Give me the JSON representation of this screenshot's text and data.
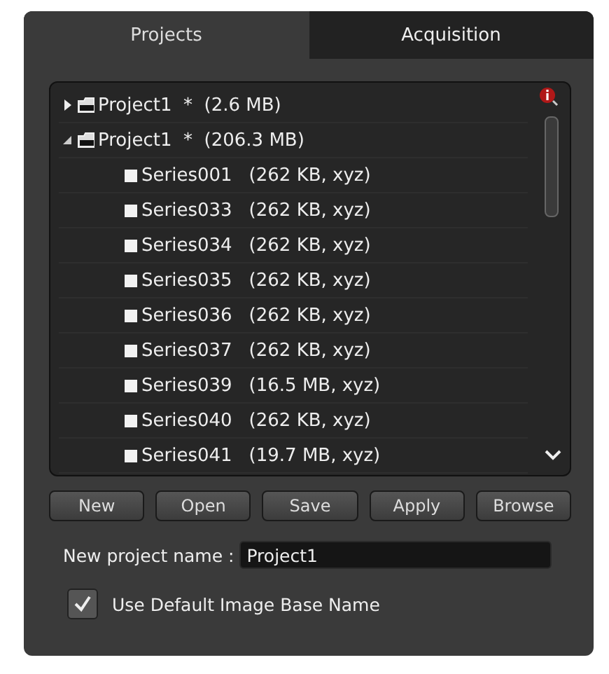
{
  "tabs": [
    {
      "label": "Projects",
      "selected": true
    },
    {
      "label": "Acquisition",
      "selected": false
    }
  ],
  "tree": [
    {
      "label": "Project1  *  (2.6 MB)",
      "expanded": false
    },
    {
      "label": "Project1  *  (206.3 MB)",
      "expanded": true,
      "children": [
        {
          "name": "Series001",
          "info": "(262 KB, xyz)"
        },
        {
          "name": "Series033",
          "info": "(262 KB, xyz)"
        },
        {
          "name": "Series034",
          "info": "(262 KB, xyz)"
        },
        {
          "name": "Series035",
          "info": "(262 KB, xyz)"
        },
        {
          "name": "Series036",
          "info": "(262 KB, xyz)"
        },
        {
          "name": "Series037",
          "info": "(262 KB, xyz)"
        },
        {
          "name": "Series039",
          "info": "(16.5 MB, xyz)"
        },
        {
          "name": "Series040",
          "info": "(262 KB, xyz)"
        },
        {
          "name": "Series041",
          "info": "(19.7 MB, xyz)"
        }
      ]
    }
  ],
  "buttons": [
    "New",
    "Open",
    "Save",
    "Apply",
    "Browse"
  ],
  "project_name": {
    "label": "New project name :",
    "value": "Project1"
  },
  "default_name": {
    "label": "Use Default Image Base Name",
    "checked": true
  }
}
